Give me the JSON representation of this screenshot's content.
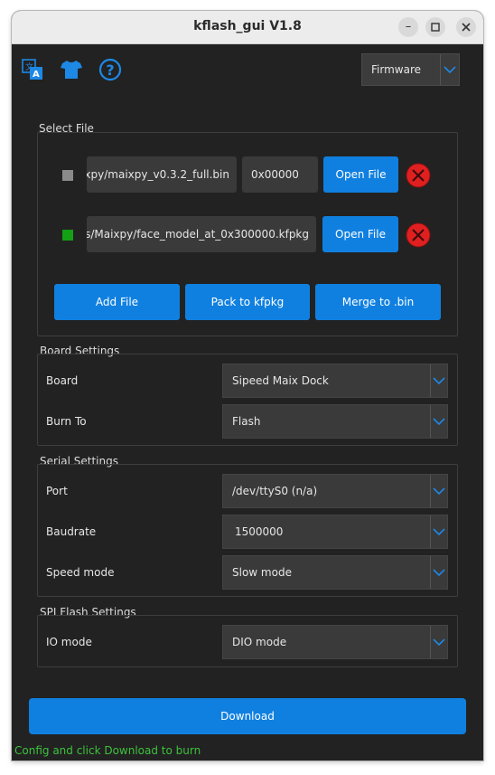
{
  "window": {
    "title": "kflash_gui V1.8",
    "minimize_icon": "minimize-icon",
    "maximize_icon": "maximize-icon",
    "close_icon": "close-icon"
  },
  "toolbar": {
    "icons": [
      "language-icon",
      "skin-icon",
      "help-icon"
    ],
    "mode_select": "Firmware"
  },
  "select_file": {
    "label": "Select File",
    "files": [
      {
        "path": "xpy/maixpy_v0.3.2_full.bin",
        "address": "0x00000",
        "open_label": "Open File",
        "enabled": false
      },
      {
        "path": "ıs/Maixpy/face_model_at_0x300000.kfpkg",
        "open_label": "Open File",
        "enabled": true
      }
    ],
    "add_file": "Add File",
    "pack": "Pack to kfpkg",
    "merge": "Merge to .bin"
  },
  "board_settings": {
    "label": "Board Settings",
    "board_label": "Board",
    "board_value": "Sipeed Maix Dock",
    "burn_label": "Burn To",
    "burn_value": "Flash"
  },
  "serial_settings": {
    "label": "Serial Settings",
    "port_label": "Port",
    "port_value": "/dev/ttyS0 (n/a)",
    "baud_label": "Baudrate",
    "baud_value": "1500000",
    "speed_label": "Speed mode",
    "speed_value": "Slow mode"
  },
  "spi_settings": {
    "label": "SPI Flash Settings",
    "io_label": "IO mode",
    "io_value": "DIO mode"
  },
  "download_label": "Download",
  "status_text": "Config and click Download to burn",
  "colors": {
    "accent": "#1080e0",
    "background": "#222222",
    "status": "#3cc23c",
    "remove": "#e02020",
    "checked": "#14a014",
    "unchecked": "#8a8a8a"
  }
}
